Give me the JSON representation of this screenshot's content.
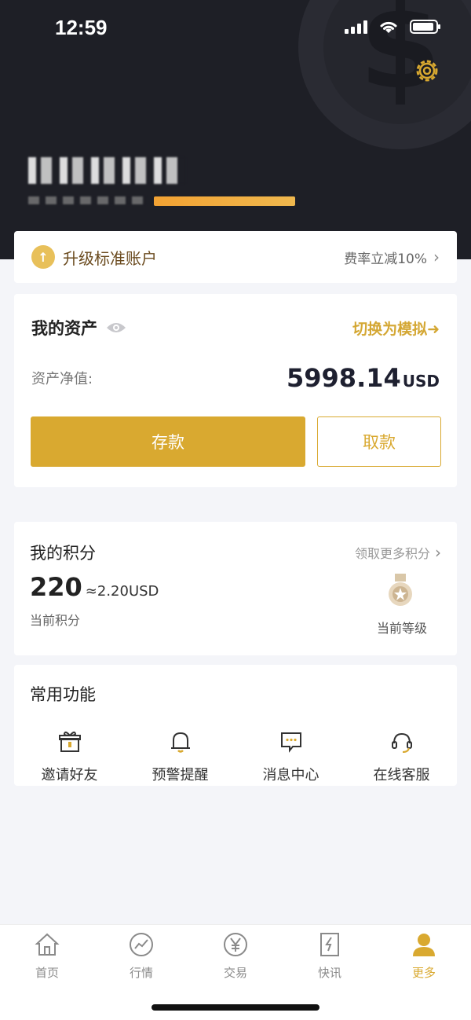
{
  "status_bar": {
    "time": "12:59"
  },
  "upgrade": {
    "title": "升级标准账户",
    "promo": "费率立减10%"
  },
  "assets": {
    "title": "我的资产",
    "switch_label": "切换为模拟➜",
    "net_label": "资产净值:",
    "net_value": "5998.14",
    "net_unit": "USD",
    "deposit_label": "存款",
    "withdraw_label": "取款"
  },
  "points": {
    "title": "我的积分",
    "more_label": "领取更多积分",
    "value": "220",
    "usd_value": "≈2.20USD",
    "current_label": "当前积分",
    "level_label": "当前等级"
  },
  "functions": {
    "title": "常用功能",
    "items": [
      {
        "label": "邀请好友",
        "icon": "gift-icon"
      },
      {
        "label": "预警提醒",
        "icon": "bell-icon"
      },
      {
        "label": "消息中心",
        "icon": "message-icon"
      },
      {
        "label": "在线客服",
        "icon": "headset-icon"
      }
    ]
  },
  "tabbar": {
    "items": [
      {
        "label": "首页",
        "icon": "home-icon"
      },
      {
        "label": "行情",
        "icon": "chart-icon"
      },
      {
        "label": "交易",
        "icon": "yen-icon"
      },
      {
        "label": "快讯",
        "icon": "news-icon"
      },
      {
        "label": "更多",
        "icon": "user-icon",
        "active": true
      }
    ]
  },
  "colors": {
    "accent": "#d9a930",
    "header_bg": "#1e1f26",
    "page_bg": "#f4f5f9"
  }
}
